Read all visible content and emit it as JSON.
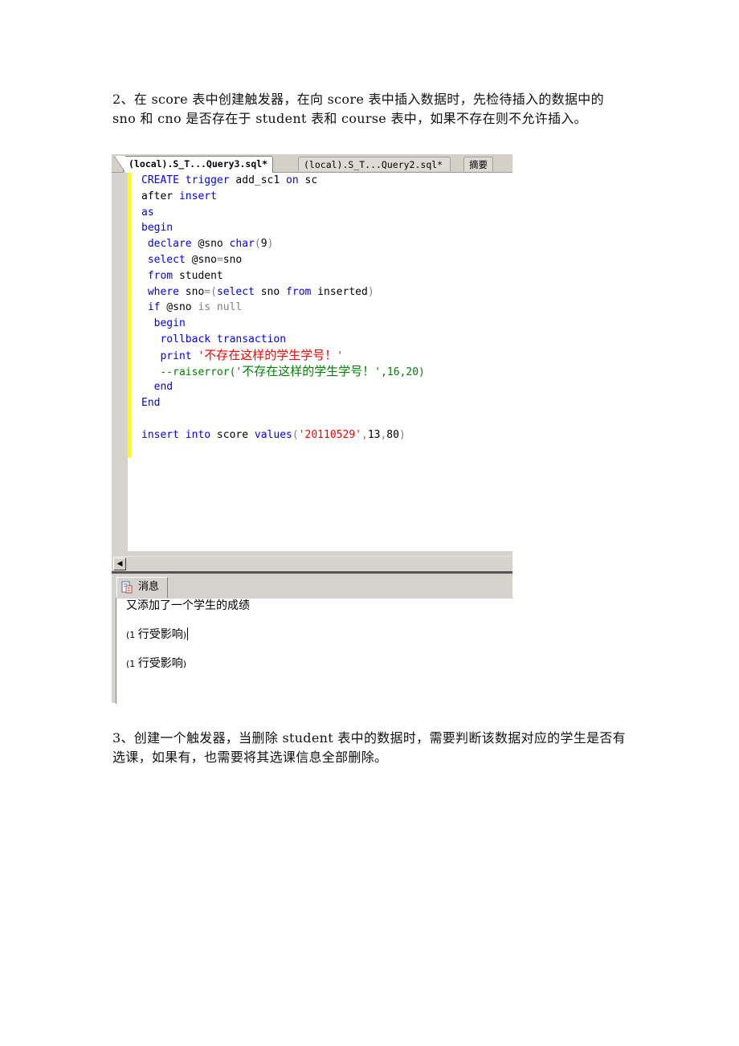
{
  "document": {
    "paragraph_2": "2、在 score 表中创建触发器，在向 score 表中插入数据时，先检待插入的数据中的 sno 和 cno 是否存在于 student 表和 course 表中，如果不存在则不允许插入。",
    "paragraph_3": "3、创建一个触发器，当删除 student 表中的数据时，需要判断该数据对应的学生是否有选课，如果有，也需要将其选课信息全部删除。"
  },
  "screenshot": {
    "tabs": [
      {
        "label": "(local).S_T...Query3.sql*",
        "active": true
      },
      {
        "label": "(local).S_T...Query2.sql*",
        "active": false
      },
      {
        "label": "摘要",
        "active": false
      }
    ],
    "code_lines": [
      {
        "tokens": [
          {
            "t": "CREATE",
            "c": "kw"
          },
          {
            "t": " "
          },
          {
            "t": "trigger",
            "c": "kw"
          },
          {
            "t": " add_sc1 "
          },
          {
            "t": "on",
            "c": "kw"
          },
          {
            "t": " sc"
          }
        ]
      },
      {
        "tokens": [
          {
            "t": "after "
          },
          {
            "t": "insert",
            "c": "kw"
          }
        ]
      },
      {
        "tokens": [
          {
            "t": "as",
            "c": "kw"
          }
        ]
      },
      {
        "tokens": [
          {
            "t": "begin",
            "c": "kw"
          }
        ]
      },
      {
        "tokens": [
          {
            "t": " "
          },
          {
            "t": "declare",
            "c": "kw"
          },
          {
            "t": " @sno "
          },
          {
            "t": "char",
            "c": "kw"
          },
          {
            "t": "(",
            "c": "op"
          },
          {
            "t": "9"
          },
          {
            "t": ")",
            "c": "op"
          }
        ]
      },
      {
        "tokens": [
          {
            "t": " "
          },
          {
            "t": "select",
            "c": "kw"
          },
          {
            "t": " @sno"
          },
          {
            "t": "=",
            "c": "op"
          },
          {
            "t": "sno"
          }
        ]
      },
      {
        "tokens": [
          {
            "t": " "
          },
          {
            "t": "from",
            "c": "kw"
          },
          {
            "t": " student"
          }
        ]
      },
      {
        "tokens": [
          {
            "t": " "
          },
          {
            "t": "where",
            "c": "kw"
          },
          {
            "t": " sno"
          },
          {
            "t": "=(",
            "c": "op"
          },
          {
            "t": "select",
            "c": "kw"
          },
          {
            "t": " sno "
          },
          {
            "t": "from",
            "c": "kw"
          },
          {
            "t": " inserted"
          },
          {
            "t": ")",
            "c": "op"
          }
        ]
      },
      {
        "tokens": [
          {
            "t": " "
          },
          {
            "t": "if",
            "c": "kw"
          },
          {
            "t": " @sno "
          },
          {
            "t": "is null",
            "c": "op"
          }
        ]
      },
      {
        "tokens": [
          {
            "t": "  "
          },
          {
            "t": "begin",
            "c": "kw"
          }
        ]
      },
      {
        "tokens": [
          {
            "t": "   "
          },
          {
            "t": "rollback transaction",
            "c": "kw"
          }
        ]
      },
      {
        "tokens": [
          {
            "t": "   "
          },
          {
            "t": "print",
            "c": "kw"
          },
          {
            "t": " "
          },
          {
            "t": "'",
            "c": "str"
          },
          {
            "t": "不存在这样的学生学号！",
            "c": "str cjk"
          },
          {
            "t": "'",
            "c": "str"
          }
        ]
      },
      {
        "tokens": [
          {
            "t": "   --raiserror('",
            "c": "cm"
          },
          {
            "t": "不存在这样的学生学号！",
            "c": "cm cjk"
          },
          {
            "t": "',16,20)",
            "c": "cm"
          }
        ]
      },
      {
        "tokens": [
          {
            "t": "  "
          },
          {
            "t": "end",
            "c": "kw"
          }
        ]
      },
      {
        "tokens": [
          {
            "t": "End",
            "c": "kw"
          }
        ]
      },
      {
        "tokens": [
          {
            "t": ""
          }
        ]
      },
      {
        "tokens": [
          {
            "t": "insert",
            "c": "kw"
          },
          {
            "t": " "
          },
          {
            "t": "into",
            "c": "kw"
          },
          {
            "t": " score "
          },
          {
            "t": "values",
            "c": "kw"
          },
          {
            "t": "(",
            "c": "op"
          },
          {
            "t": "'20110529'",
            "c": "str"
          },
          {
            "t": ",",
            "c": "op"
          },
          {
            "t": "13"
          },
          {
            "t": ",",
            "c": "op"
          },
          {
            "t": "80"
          },
          {
            "t": ")",
            "c": "op"
          }
        ]
      }
    ],
    "results_tab_label": "消息",
    "messages": [
      {
        "prefix": "",
        "text": "又添加了一个学生的成绩",
        "suffix": ""
      },
      {
        "prefix": "(1 ",
        "text": "行受影响",
        "suffix": ")"
      },
      {
        "prefix": "(1 ",
        "text": "行受影响",
        "suffix": ")"
      }
    ],
    "colors": {
      "keyword": "#0000ff",
      "string": "#ff0000",
      "comment": "#008000",
      "operator": "#808080",
      "change_bar": "#ffff00"
    }
  }
}
